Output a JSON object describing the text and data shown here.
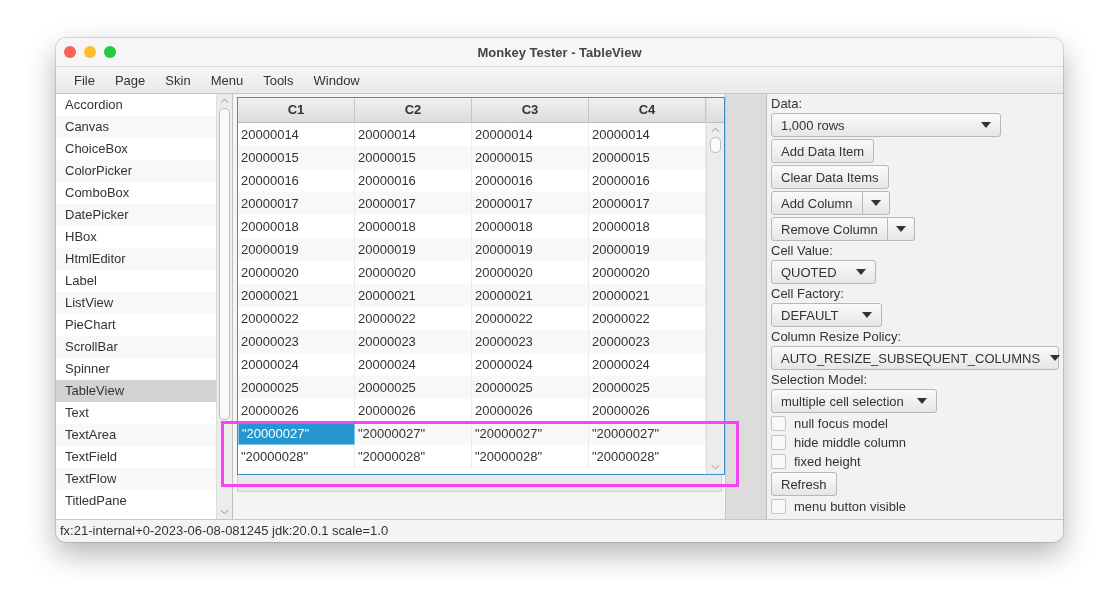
{
  "window": {
    "title": "Monkey Tester - TableView"
  },
  "menu": [
    "File",
    "Page",
    "Skin",
    "Menu",
    "Tools",
    "Window"
  ],
  "sidebar": {
    "items": [
      {
        "label": "Accordion",
        "selected": false
      },
      {
        "label": "Canvas",
        "selected": false
      },
      {
        "label": "ChoiceBox",
        "selected": false
      },
      {
        "label": "ColorPicker",
        "selected": false
      },
      {
        "label": "ComboBox",
        "selected": false
      },
      {
        "label": "DatePicker",
        "selected": false
      },
      {
        "label": "HBox",
        "selected": false
      },
      {
        "label": "HtmlEditor",
        "selected": false
      },
      {
        "label": "Label",
        "selected": false
      },
      {
        "label": "ListView",
        "selected": false
      },
      {
        "label": "PieChart",
        "selected": false
      },
      {
        "label": "ScrollBar",
        "selected": false
      },
      {
        "label": "Spinner",
        "selected": false
      },
      {
        "label": "TableView",
        "selected": true
      },
      {
        "label": "Text",
        "selected": false
      },
      {
        "label": "TextArea",
        "selected": false
      },
      {
        "label": "TextField",
        "selected": false
      },
      {
        "label": "TextFlow",
        "selected": false
      },
      {
        "label": "TitledPane",
        "selected": false
      }
    ]
  },
  "table": {
    "columns": [
      "C1",
      "C2",
      "C3",
      "C4"
    ],
    "rows": [
      {
        "cells": [
          {
            "text": "20000014",
            "selected": false
          },
          {
            "text": "20000014",
            "selected": false
          },
          {
            "text": "20000014",
            "selected": false
          },
          {
            "text": "20000014",
            "selected": false
          }
        ]
      },
      {
        "cells": [
          {
            "text": "20000015",
            "selected": false
          },
          {
            "text": "20000015",
            "selected": false
          },
          {
            "text": "20000015",
            "selected": false
          },
          {
            "text": "20000015",
            "selected": false
          }
        ]
      },
      {
        "cells": [
          {
            "text": "20000016",
            "selected": false
          },
          {
            "text": "20000016",
            "selected": false
          },
          {
            "text": "20000016",
            "selected": false
          },
          {
            "text": "20000016",
            "selected": false
          }
        ]
      },
      {
        "cells": [
          {
            "text": "20000017",
            "selected": false
          },
          {
            "text": "20000017",
            "selected": false
          },
          {
            "text": "20000017",
            "selected": false
          },
          {
            "text": "20000017",
            "selected": false
          }
        ]
      },
      {
        "cells": [
          {
            "text": "20000018",
            "selected": false
          },
          {
            "text": "20000018",
            "selected": false
          },
          {
            "text": "20000018",
            "selected": false
          },
          {
            "text": "20000018",
            "selected": false
          }
        ]
      },
      {
        "cells": [
          {
            "text": "20000019",
            "selected": false
          },
          {
            "text": "20000019",
            "selected": false
          },
          {
            "text": "20000019",
            "selected": false
          },
          {
            "text": "20000019",
            "selected": false
          }
        ]
      },
      {
        "cells": [
          {
            "text": "20000020",
            "selected": false
          },
          {
            "text": "20000020",
            "selected": false
          },
          {
            "text": "20000020",
            "selected": false
          },
          {
            "text": "20000020",
            "selected": false
          }
        ]
      },
      {
        "cells": [
          {
            "text": "20000021",
            "selected": false
          },
          {
            "text": "20000021",
            "selected": false
          },
          {
            "text": "20000021",
            "selected": false
          },
          {
            "text": "20000021",
            "selected": false
          }
        ]
      },
      {
        "cells": [
          {
            "text": "20000022",
            "selected": false
          },
          {
            "text": "20000022",
            "selected": false
          },
          {
            "text": "20000022",
            "selected": false
          },
          {
            "text": "20000022",
            "selected": false
          }
        ]
      },
      {
        "cells": [
          {
            "text": "20000023",
            "selected": false
          },
          {
            "text": "20000023",
            "selected": false
          },
          {
            "text": "20000023",
            "selected": false
          },
          {
            "text": "20000023",
            "selected": false
          }
        ]
      },
      {
        "cells": [
          {
            "text": "20000024",
            "selected": false
          },
          {
            "text": "20000024",
            "selected": false
          },
          {
            "text": "20000024",
            "selected": false
          },
          {
            "text": "20000024",
            "selected": false
          }
        ]
      },
      {
        "cells": [
          {
            "text": "20000025",
            "selected": false
          },
          {
            "text": "20000025",
            "selected": false
          },
          {
            "text": "20000025",
            "selected": false
          },
          {
            "text": "20000025",
            "selected": false
          }
        ]
      },
      {
        "cells": [
          {
            "text": "20000026",
            "selected": false
          },
          {
            "text": "20000026",
            "selected": false
          },
          {
            "text": "20000026",
            "selected": false
          },
          {
            "text": "20000026",
            "selected": false
          }
        ]
      },
      {
        "cells": [
          {
            "text": "\"20000027\"",
            "selected": true
          },
          {
            "text": "\"20000027\"",
            "selected": false
          },
          {
            "text": "\"20000027\"",
            "selected": false
          },
          {
            "text": "\"20000027\"",
            "selected": false
          }
        ]
      },
      {
        "cells": [
          {
            "text": "\"20000028\"",
            "selected": false
          },
          {
            "text": "\"20000028\"",
            "selected": false
          },
          {
            "text": "\"20000028\"",
            "selected": false
          },
          {
            "text": "\"20000028\"",
            "selected": false
          }
        ]
      }
    ]
  },
  "panel": [
    {
      "kind": "label",
      "text": "Data:"
    },
    {
      "kind": "combo",
      "text": "1,000 rows"
    },
    {
      "kind": "button",
      "text": "Add Data Item"
    },
    {
      "kind": "button",
      "text": "Clear Data Items"
    },
    {
      "kind": "split",
      "text": "Add Column"
    },
    {
      "kind": "split",
      "text": "Remove Column"
    },
    {
      "kind": "label",
      "text": "Cell Value:"
    },
    {
      "kind": "combo",
      "text": "QUOTED"
    },
    {
      "kind": "label",
      "text": "Cell Factory:"
    },
    {
      "kind": "combo",
      "text": "DEFAULT"
    },
    {
      "kind": "label",
      "text": "Column Resize Policy:"
    },
    {
      "kind": "combo",
      "text": "AUTO_RESIZE_SUBSEQUENT_COLUMNS"
    },
    {
      "kind": "label",
      "text": "Selection Model:"
    },
    {
      "kind": "combo",
      "text": "multiple cell selection"
    },
    {
      "kind": "checkbox",
      "text": "null focus model",
      "checked": false
    },
    {
      "kind": "checkbox",
      "text": "hide middle column",
      "checked": false
    },
    {
      "kind": "checkbox",
      "text": "fixed height",
      "checked": false
    },
    {
      "kind": "button",
      "text": "Refresh"
    },
    {
      "kind": "checkbox",
      "text": "menu button visible",
      "checked": false
    }
  ],
  "status_bar": "fx:21-internal+0-2023-06-08-081245 jdk:20.0.1 scale=1.0"
}
